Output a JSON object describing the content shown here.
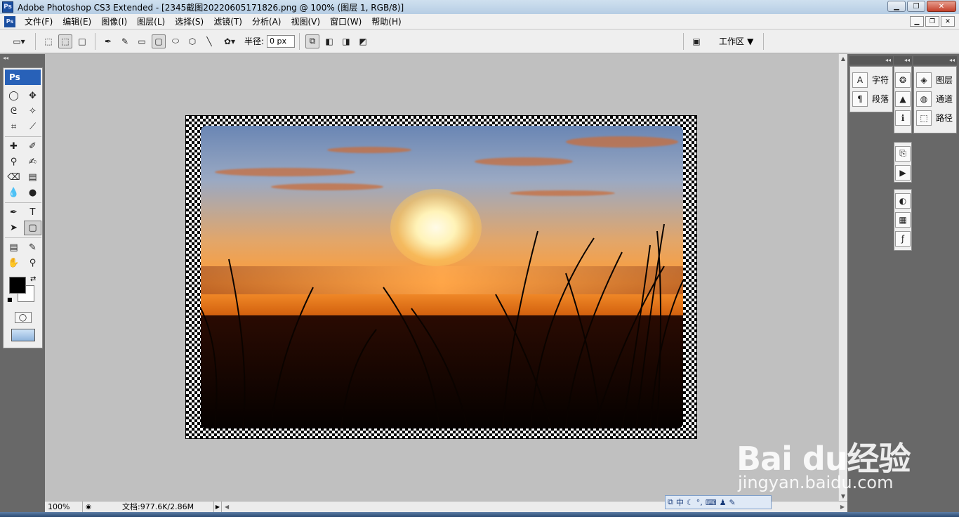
{
  "titlebar": {
    "logo": "Ps",
    "title": "Adobe Photoshop CS3 Extended - [2345截图20220605171826.png @ 100% (图层 1, RGB/8)]",
    "buttons": [
      "minimize",
      "maximize",
      "close"
    ]
  },
  "menubar": {
    "logo": "Ps",
    "items": [
      "文件(F)",
      "编辑(E)",
      "图像(I)",
      "图层(L)",
      "选择(S)",
      "滤镜(T)",
      "分析(A)",
      "视图(V)",
      "窗口(W)",
      "帮助(H)"
    ]
  },
  "options": {
    "radius_label": "半径:",
    "radius_value": "0 px",
    "workspace_label": "工作区"
  },
  "toolbox": {
    "logo": "Ps"
  },
  "panels": {
    "col1": [
      {
        "label": "字符",
        "icon": "character-icon"
      },
      {
        "label": "段落",
        "icon": "paragraph-icon"
      }
    ],
    "col3": [
      {
        "label": "图层",
        "icon": "layers-icon"
      },
      {
        "label": "通道",
        "icon": "channels-icon"
      },
      {
        "label": "路径",
        "icon": "paths-icon"
      }
    ]
  },
  "statusbar": {
    "zoom": "100%",
    "doc_info": "文档:977.6K/2.86M"
  },
  "ime": {
    "mode": "中"
  },
  "watermark": {
    "main": "Bai du经验",
    "sub": "jingyan.baidu.com"
  }
}
